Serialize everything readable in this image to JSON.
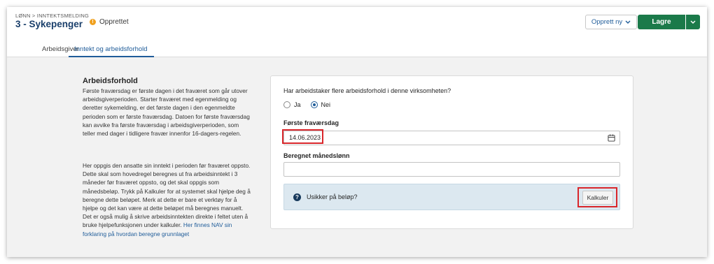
{
  "header": {
    "breadcrumb": "LØNN > INNTEKTSMELDING",
    "title": "3 - Sykepenger",
    "status": "Opprettet",
    "create_button": "Opprett ny",
    "save_button": "Lagre"
  },
  "tabs": [
    {
      "label": "Arbeidsgiver",
      "active": false
    },
    {
      "label": "Inntekt og arbeidsforhold",
      "active": true
    }
  ],
  "info": {
    "title": "Arbeidsforhold",
    "paragraph1": "Første fraværsdag er første dagen i det fraværet som går utover arbeidsgiverperioden. Starter fraværet med egenmelding og deretter sykemelding, er det første dagen i den egenmeldte perioden som er første fraværsdag. Datoen for første fraværsdag kan avvike fra første fraværsdag i arbeidsgiverperioden, som teller med dager i tidligere fravær innenfor 16-dagers-regelen.",
    "paragraph2": "Her oppgis den ansatte sin inntekt i perioden før fraværet oppsto. Dette skal som hovedregel beregnes ut fra arbeidsinntekt i 3 måneder før fraværet oppsto, og det skal oppgis som månedsbeløp. Trykk på Kalkuler for at systemet skal hjelpe deg å beregne dette beløpet. Merk at dette er bare et verktøy for å hjelpe og det kan være at dette beløpet må beregnes manuelt. Det er også mulig å skrive arbeidsinntekten direkte i feltet uten å bruke hjelpefunksjonen under kalkuler.",
    "link": "Her finnes NAV sin forklaring på hvordan beregne grunnlaget"
  },
  "form": {
    "question": "Har arbeidstaker flere arbeidsforhold i denne virksomheten?",
    "radio_yes": "Ja",
    "radio_no": "Nei",
    "selected": "Nei",
    "first_absence_label": "Første fraværsdag",
    "first_absence_value": "14.06.2023",
    "monthly_salary_label": "Beregnet månedslønn",
    "monthly_salary_value": "",
    "help_text": "Usikker på beløp?",
    "calc_button": "Kalkuler"
  },
  "colors": {
    "brand_blue": "#1f5c99",
    "save_green": "#1b7a4a",
    "highlight_red": "#d9262b",
    "status_orange": "#f0a01e"
  },
  "icons": {
    "status": "info-dot-icon",
    "create_dropdown": "chevron-down-icon",
    "save_dropdown": "chevron-down-icon",
    "date_picker": "calendar-icon",
    "help": "question-icon"
  }
}
